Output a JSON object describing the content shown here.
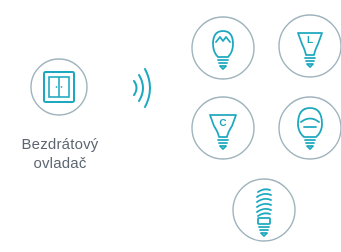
{
  "remote": {
    "label_line1": "Bezdrátový",
    "label_line2": "ovladač",
    "icon": "wireless-switch-icon"
  },
  "signal": {
    "icon": "wireless-signal-icon"
  },
  "bulbs": [
    {
      "name": "bulb-flame-icon",
      "letter": ""
    },
    {
      "name": "bulb-reflector-l-icon",
      "letter": "L"
    },
    {
      "name": "bulb-reflector-c-icon",
      "letter": "C"
    },
    {
      "name": "bulb-globe-icon",
      "letter": ""
    },
    {
      "name": "bulb-spiral-icon",
      "letter": ""
    }
  ],
  "colors": {
    "accent": "#1ea8bf",
    "circle": "#9fb3bd",
    "text": "#5b6670"
  }
}
